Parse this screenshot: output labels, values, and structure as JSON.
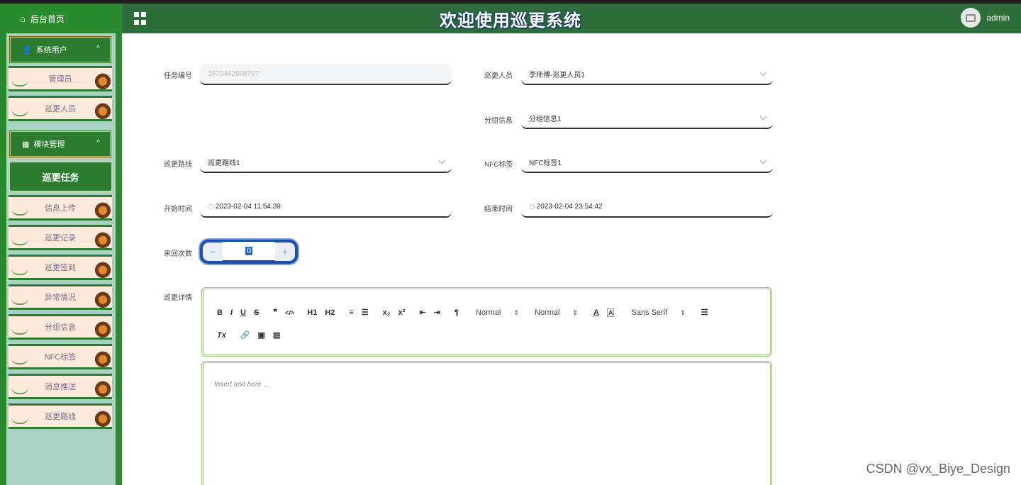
{
  "header": {
    "home_label": "后台首页",
    "title": "欢迎使用巡更系统",
    "username": "admin"
  },
  "sidebar": {
    "group1": {
      "label": "系统用户",
      "items": [
        "管理员",
        "巡更人员"
      ]
    },
    "group2": {
      "label": "模块管理",
      "active": "巡更任务",
      "items": [
        "信息上传",
        "巡更记录",
        "巡更签到",
        "异常情况",
        "分组信息",
        "NFC标签",
        "消息推送",
        "巡更路线"
      ]
    }
  },
  "form": {
    "task_no": {
      "label": "任务编号",
      "value": "1675482868767"
    },
    "patroller": {
      "label": "巡更人员",
      "value": "李师傅-巡更人员1"
    },
    "group": {
      "label": "分组信息",
      "value": "分组信息1"
    },
    "route": {
      "label": "巡更路线",
      "value": "巡更路线1"
    },
    "nfc": {
      "label": "NFC标签",
      "value": "NFC标签1"
    },
    "start_time": {
      "label": "开始时间",
      "value": "2023-02-04 11:54:39"
    },
    "end_time": {
      "label": "结束时间",
      "value": "2023-02-04 23:54:42"
    },
    "round_trips": {
      "label": "来回次数",
      "value": "0",
      "minus": "−",
      "plus": "+"
    },
    "details": {
      "label": "巡更详情",
      "placeholder": "Insert text here ..."
    }
  },
  "editor_toolbar": {
    "row1": [
      "B",
      "I",
      "U",
      "S",
      "❞",
      "</>",
      "H1",
      "H2",
      "≡",
      "☰",
      "x₂",
      "x²",
      "⇤",
      "⇥",
      "¶"
    ],
    "header_select": "Normal",
    "size_select": "Normal",
    "font_select": "Sans Serif",
    "row2": [
      "Tx",
      "🔗",
      "▣",
      "▤"
    ]
  },
  "watermark": "CSDN @vx_Biye_Design"
}
